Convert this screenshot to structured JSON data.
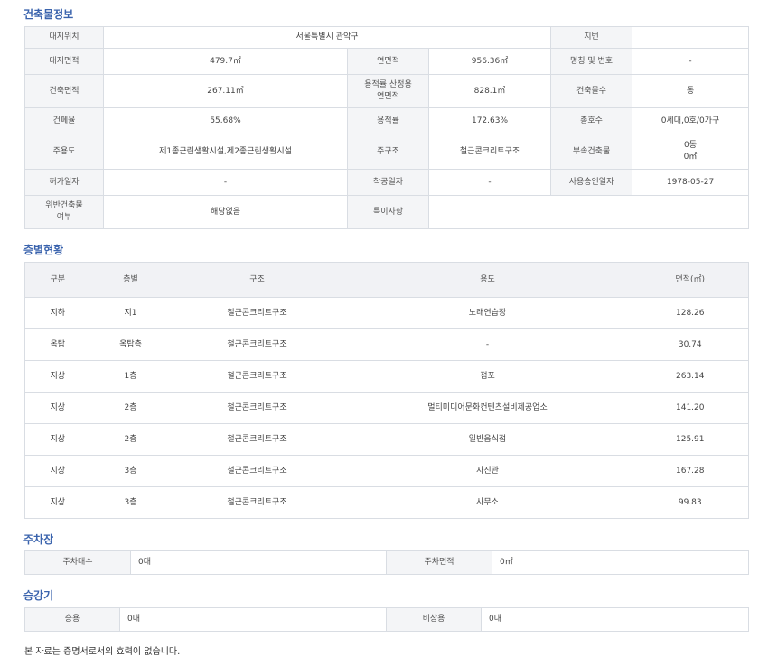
{
  "building": {
    "title": "건축물정보",
    "site_location_label": "대지위치",
    "site_location": "서울특별시 관악구",
    "lot_number_label": "지번",
    "lot_number": "",
    "site_area_label": "대지면적",
    "site_area": "479.7㎡",
    "total_floor_area_label": "연면적",
    "total_floor_area": "956.36㎡",
    "name_label": "명칭 및 번호",
    "name": "-",
    "building_area_label": "건축면적",
    "building_area": "267.11㎡",
    "far_floor_area_label_1": "용적률 산정용",
    "far_floor_area_label_2": "연면적",
    "far_floor_area": "828.1㎡",
    "building_count_label": "건축물수",
    "building_count": "동",
    "coverage_label": "건폐율",
    "coverage": "55.68%",
    "far_label": "용적률",
    "far": "172.63%",
    "households_label": "총호수",
    "households": "0세대,0호/0가구",
    "main_use_label": "주용도",
    "main_use": "제1종근린생활시설,제2종근린생활시설",
    "main_structure_label": "주구조",
    "main_structure": "철근콘크리트구조",
    "annex_label": "부속건축물",
    "annex_count": "0동",
    "annex_area": "0㎡",
    "permit_date_label": "허가일자",
    "permit_date": "-",
    "start_date_label": "착공일자",
    "start_date": "-",
    "approval_date_label": "사용승인일자",
    "approval_date": "1978-05-27",
    "violation_label_1": "위반건축물",
    "violation_label_2": "여부",
    "violation": "해당없음",
    "remarks_label": "특이사항",
    "remarks": ""
  },
  "floors": {
    "title": "층별현황",
    "headers": [
      "구분",
      "층별",
      "구조",
      "용도",
      "면적(㎡)"
    ],
    "rows": [
      [
        "지하",
        "지1",
        "철근콘크리트구조",
        "노래연습장",
        "128.26"
      ],
      [
        "옥탑",
        "옥탑층",
        "철근콘크리트구조",
        "-",
        "30.74"
      ],
      [
        "지상",
        "1층",
        "철근콘크리트구조",
        "점포",
        "263.14"
      ],
      [
        "지상",
        "2층",
        "철근콘크리트구조",
        "멀티미디어문화컨텐츠설비제공업소",
        "141.20"
      ],
      [
        "지상",
        "2층",
        "철근콘크리트구조",
        "일반음식점",
        "125.91"
      ],
      [
        "지상",
        "3층",
        "철근콘크리트구조",
        "사진관",
        "167.28"
      ],
      [
        "지상",
        "3층",
        "철근콘크리트구조",
        "사무소",
        "99.83"
      ]
    ]
  },
  "parking": {
    "title": "주차장",
    "count_label": "주차대수",
    "count": "0대",
    "area_label": "주차면적",
    "area": "0㎡"
  },
  "elevator": {
    "title": "승강기",
    "passenger_label": "승용",
    "passenger": "0대",
    "emergency_label": "비상용",
    "emergency": "0대"
  },
  "notice": "본 자료는 증명서로서의 효력이 없습니다."
}
